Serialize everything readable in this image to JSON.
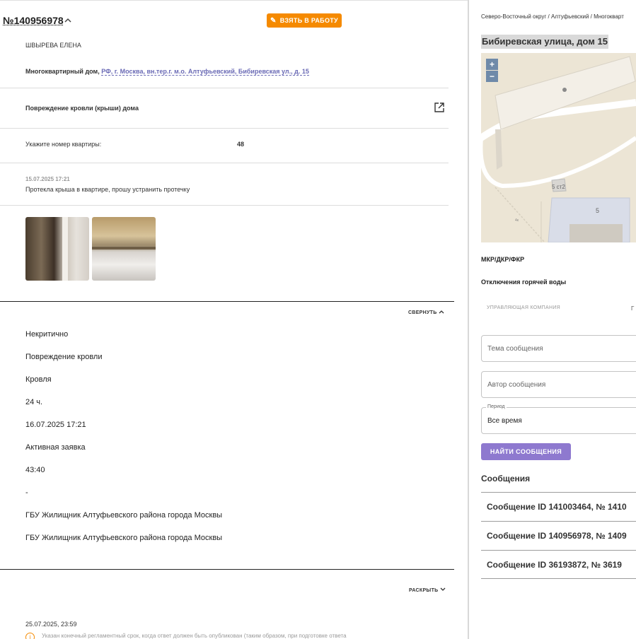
{
  "ticket": {
    "number": "№140956978",
    "take_button": "ВЗЯТЬ В РАБОТУ",
    "author": "ШВЫРЕВА ЕЛЕНА",
    "address_prefix": "Многоквартирный дом,",
    "address_link": "РФ, г. Москва, вн.тер.г. м.о. Алтуфьевский, Бибиревская ул., д. 15",
    "category": "Повреждение кровли (крыши) дома",
    "apartment_label": "Укажите номер квартиры:",
    "apartment_value": "48",
    "message_datetime": "15.07.2025 17:21",
    "message_text": "Протекла крыша в квартире, прошу устранить протечку",
    "collapse_label": "СВЕРНУТЬ",
    "expand_label": "РАСКРЫТЬ",
    "details": [
      "Некритично",
      "Повреждение кровли",
      "Кровля",
      "24 ч.",
      "16.07.2025 17:21",
      "Активная заявка",
      "43:40",
      "-",
      "ГБУ Жилищник Алтуфьевского района города Москвы",
      "ГБУ Жилищник Алтуфьевского района города Москвы"
    ],
    "deadline_date": "25.07.2025, 23:59",
    "deadline_note": "Указан конечный регламентный срок, когда ответ должен быть опубликован (таким образом, при подготовке ответа"
  },
  "side": {
    "breadcrumb": "Северо-Восточный округ / Алтуфьевский / Многокварт",
    "street": "Бибиревская улица, дом 15",
    "map": {
      "zoom_in": "+",
      "zoom_out": "−",
      "label_building_a": "5 ст2",
      "label_building_b": "5",
      "label_num": "4к"
    },
    "mkr_label": "МКР/ДКР/ФКР",
    "hot_water_label": "Отключения горячей воды",
    "mgmt_label": "УПРАВЛЯЮЩАЯ КОМПАНИЯ",
    "mgmt_trunc": "Г",
    "subject_placeholder": "Тема сообщения",
    "author_placeholder": "Автор сообщения",
    "period_legend": "Период",
    "period_value": "Все время",
    "find_button": "НАЙТИ СООБЩЕНИЯ",
    "messages_title": "Сообщения",
    "messages": [
      "Сообщение ID 141003464, № 1410",
      "Сообщение ID 140956978, № 1409",
      "Сообщение ID 36193872, № 3619"
    ]
  },
  "colors": {
    "accent_orange": "#f58a00",
    "accent_purple": "#8e79cf",
    "link": "#6a6ab5"
  },
  "icons": [
    "chevron-up-icon",
    "pencil-icon",
    "external-link-icon",
    "info-icon",
    "chevron-down-icon"
  ]
}
